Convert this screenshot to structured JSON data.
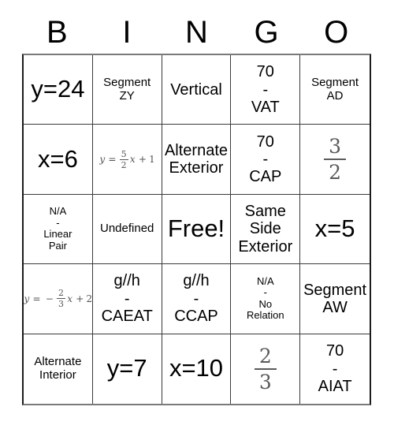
{
  "card": {
    "title": "BINGO",
    "header_letters": [
      "B",
      "I",
      "N",
      "G",
      "O"
    ],
    "free_label": "Free!",
    "colors": {
      "background": "#ffffff",
      "grid_line": "#3a3a3a",
      "outer_border_dark": "#1b1b1b",
      "outer_border_gray": "#7a7a7a",
      "text": "#000000",
      "math_text": "#555555"
    }
  },
  "rows": [
    {
      "cells": [
        {
          "lines": [
            "y=24"
          ],
          "size": "sz-xl",
          "kind": "text"
        },
        {
          "lines": [
            "Segment",
            "ZY"
          ],
          "size": "sz-sm",
          "kind": "text"
        },
        {
          "lines": [
            "Vertical"
          ],
          "size": "sz-md",
          "kind": "text"
        },
        {
          "lines": [
            "70",
            "-",
            "VAT"
          ],
          "size": "sz-md",
          "kind": "text"
        },
        {
          "lines": [
            "Segment",
            "AD"
          ],
          "size": "sz-sm",
          "kind": "text"
        }
      ]
    },
    {
      "cells": [
        {
          "lines": [
            "x=6"
          ],
          "size": "sz-xl",
          "kind": "text"
        },
        {
          "kind": "math",
          "math": {
            "lhs": "y",
            "eq": "=",
            "sign": "",
            "num": "5",
            "den": "2",
            "var": "x",
            "plus": "+",
            "const": "1"
          }
        },
        {
          "lines": [
            "Alternate",
            "Exterior"
          ],
          "size": "sz-md",
          "kind": "text"
        },
        {
          "lines": [
            "70",
            "-",
            "CAP"
          ],
          "size": "sz-md",
          "kind": "text"
        },
        {
          "kind": "fraction",
          "fraction": {
            "numerator": "3",
            "denominator": "2"
          }
        }
      ]
    },
    {
      "cells": [
        {
          "lines": [
            "N/A",
            "-",
            "Linear",
            "Pair"
          ],
          "size": "sz-xs",
          "kind": "text"
        },
        {
          "lines": [
            "Undefined"
          ],
          "size": "sz-sm",
          "kind": "text"
        },
        {
          "lines": [
            "Free!"
          ],
          "size": "sz-xl",
          "kind": "text"
        },
        {
          "lines": [
            "Same",
            "Side",
            "Exterior"
          ],
          "size": "sz-md",
          "kind": "text"
        },
        {
          "lines": [
            "x=5"
          ],
          "size": "sz-xl",
          "kind": "text"
        }
      ]
    },
    {
      "cells": [
        {
          "kind": "math",
          "math": {
            "lhs": "y",
            "eq": "=",
            "sign": "−",
            "num": "2",
            "den": "3",
            "var": "x",
            "plus": "+",
            "const": "2"
          }
        },
        {
          "lines": [
            "g//h",
            "-",
            "CAEAT"
          ],
          "size": "sz-md",
          "kind": "text"
        },
        {
          "lines": [
            "g//h",
            "-",
            "CCAP"
          ],
          "size": "sz-md",
          "kind": "text"
        },
        {
          "lines": [
            "N/A",
            "-",
            "No",
            "Relation"
          ],
          "size": "sz-xs",
          "kind": "text"
        },
        {
          "lines": [
            "Segment",
            "AW"
          ],
          "size": "sz-md",
          "kind": "text"
        }
      ]
    },
    {
      "cells": [
        {
          "lines": [
            "Alternate",
            "Interior"
          ],
          "size": "sz-sm",
          "kind": "text"
        },
        {
          "lines": [
            "y=7"
          ],
          "size": "sz-xl",
          "kind": "text"
        },
        {
          "lines": [
            "x=10"
          ],
          "size": "sz-xl",
          "kind": "text"
        },
        {
          "kind": "fraction",
          "fraction": {
            "numerator": "2",
            "denominator": "3"
          }
        },
        {
          "lines": [
            "70",
            "-",
            "AIAT"
          ],
          "size": "sz-md",
          "kind": "text"
        }
      ]
    }
  ]
}
